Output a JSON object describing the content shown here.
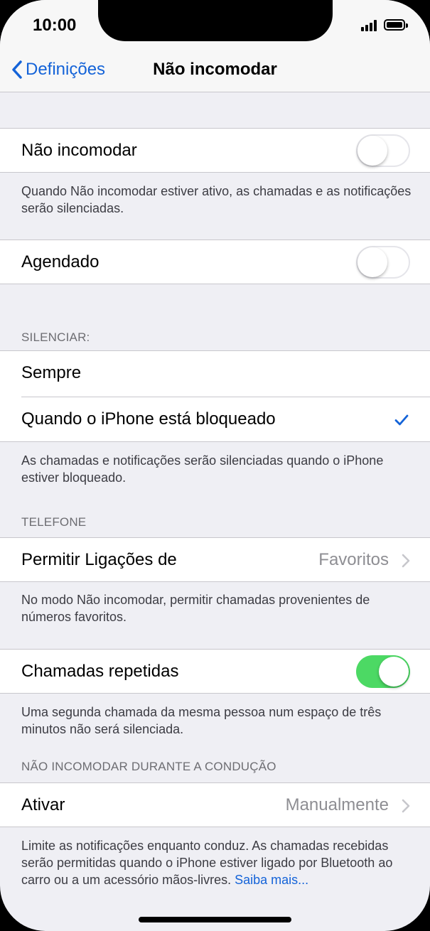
{
  "status": {
    "time": "10:00"
  },
  "nav": {
    "back_label": "Definições",
    "title": "Não incomodar"
  },
  "dnd": {
    "label": "Não incomodar",
    "enabled": false,
    "footer": "Quando Não incomodar estiver ativo, as chamadas e as notificações serão silenciadas."
  },
  "scheduled": {
    "label": "Agendado",
    "enabled": false
  },
  "silence": {
    "header": "SILENCIAR:",
    "options": [
      "Sempre",
      "Quando o iPhone está bloqueado"
    ],
    "selected": "Quando o iPhone está bloqueado",
    "footer": "As chamadas e notificações serão silenciadas quando o iPhone estiver bloqueado."
  },
  "phone": {
    "header": "TELEFONE",
    "allow_calls_label": "Permitir Ligações de",
    "allow_calls_value": "Favoritos",
    "allow_calls_footer": "No modo Não incomodar, permitir chamadas provenientes de números favoritos.",
    "repeated_label": "Chamadas repetidas",
    "repeated_enabled": true,
    "repeated_footer": "Uma segunda chamada da mesma pessoa num espaço de três minutos não será silenciada."
  },
  "driving": {
    "header": "NÃO INCOMODAR DURANTE A CONDUÇÃO",
    "activate_label": "Ativar",
    "activate_value": "Manualmente",
    "footer": "Limite as notificações enquanto conduz. As chamadas recebidas serão permitidas quando o iPhone estiver ligado por Bluetooth ao carro ou a um acessório mãos-livres.",
    "learn_more": "Saiba mais..."
  },
  "colors": {
    "accent": "#1463d8",
    "toggle_on": "#4cd964",
    "background": "#efeff4"
  }
}
